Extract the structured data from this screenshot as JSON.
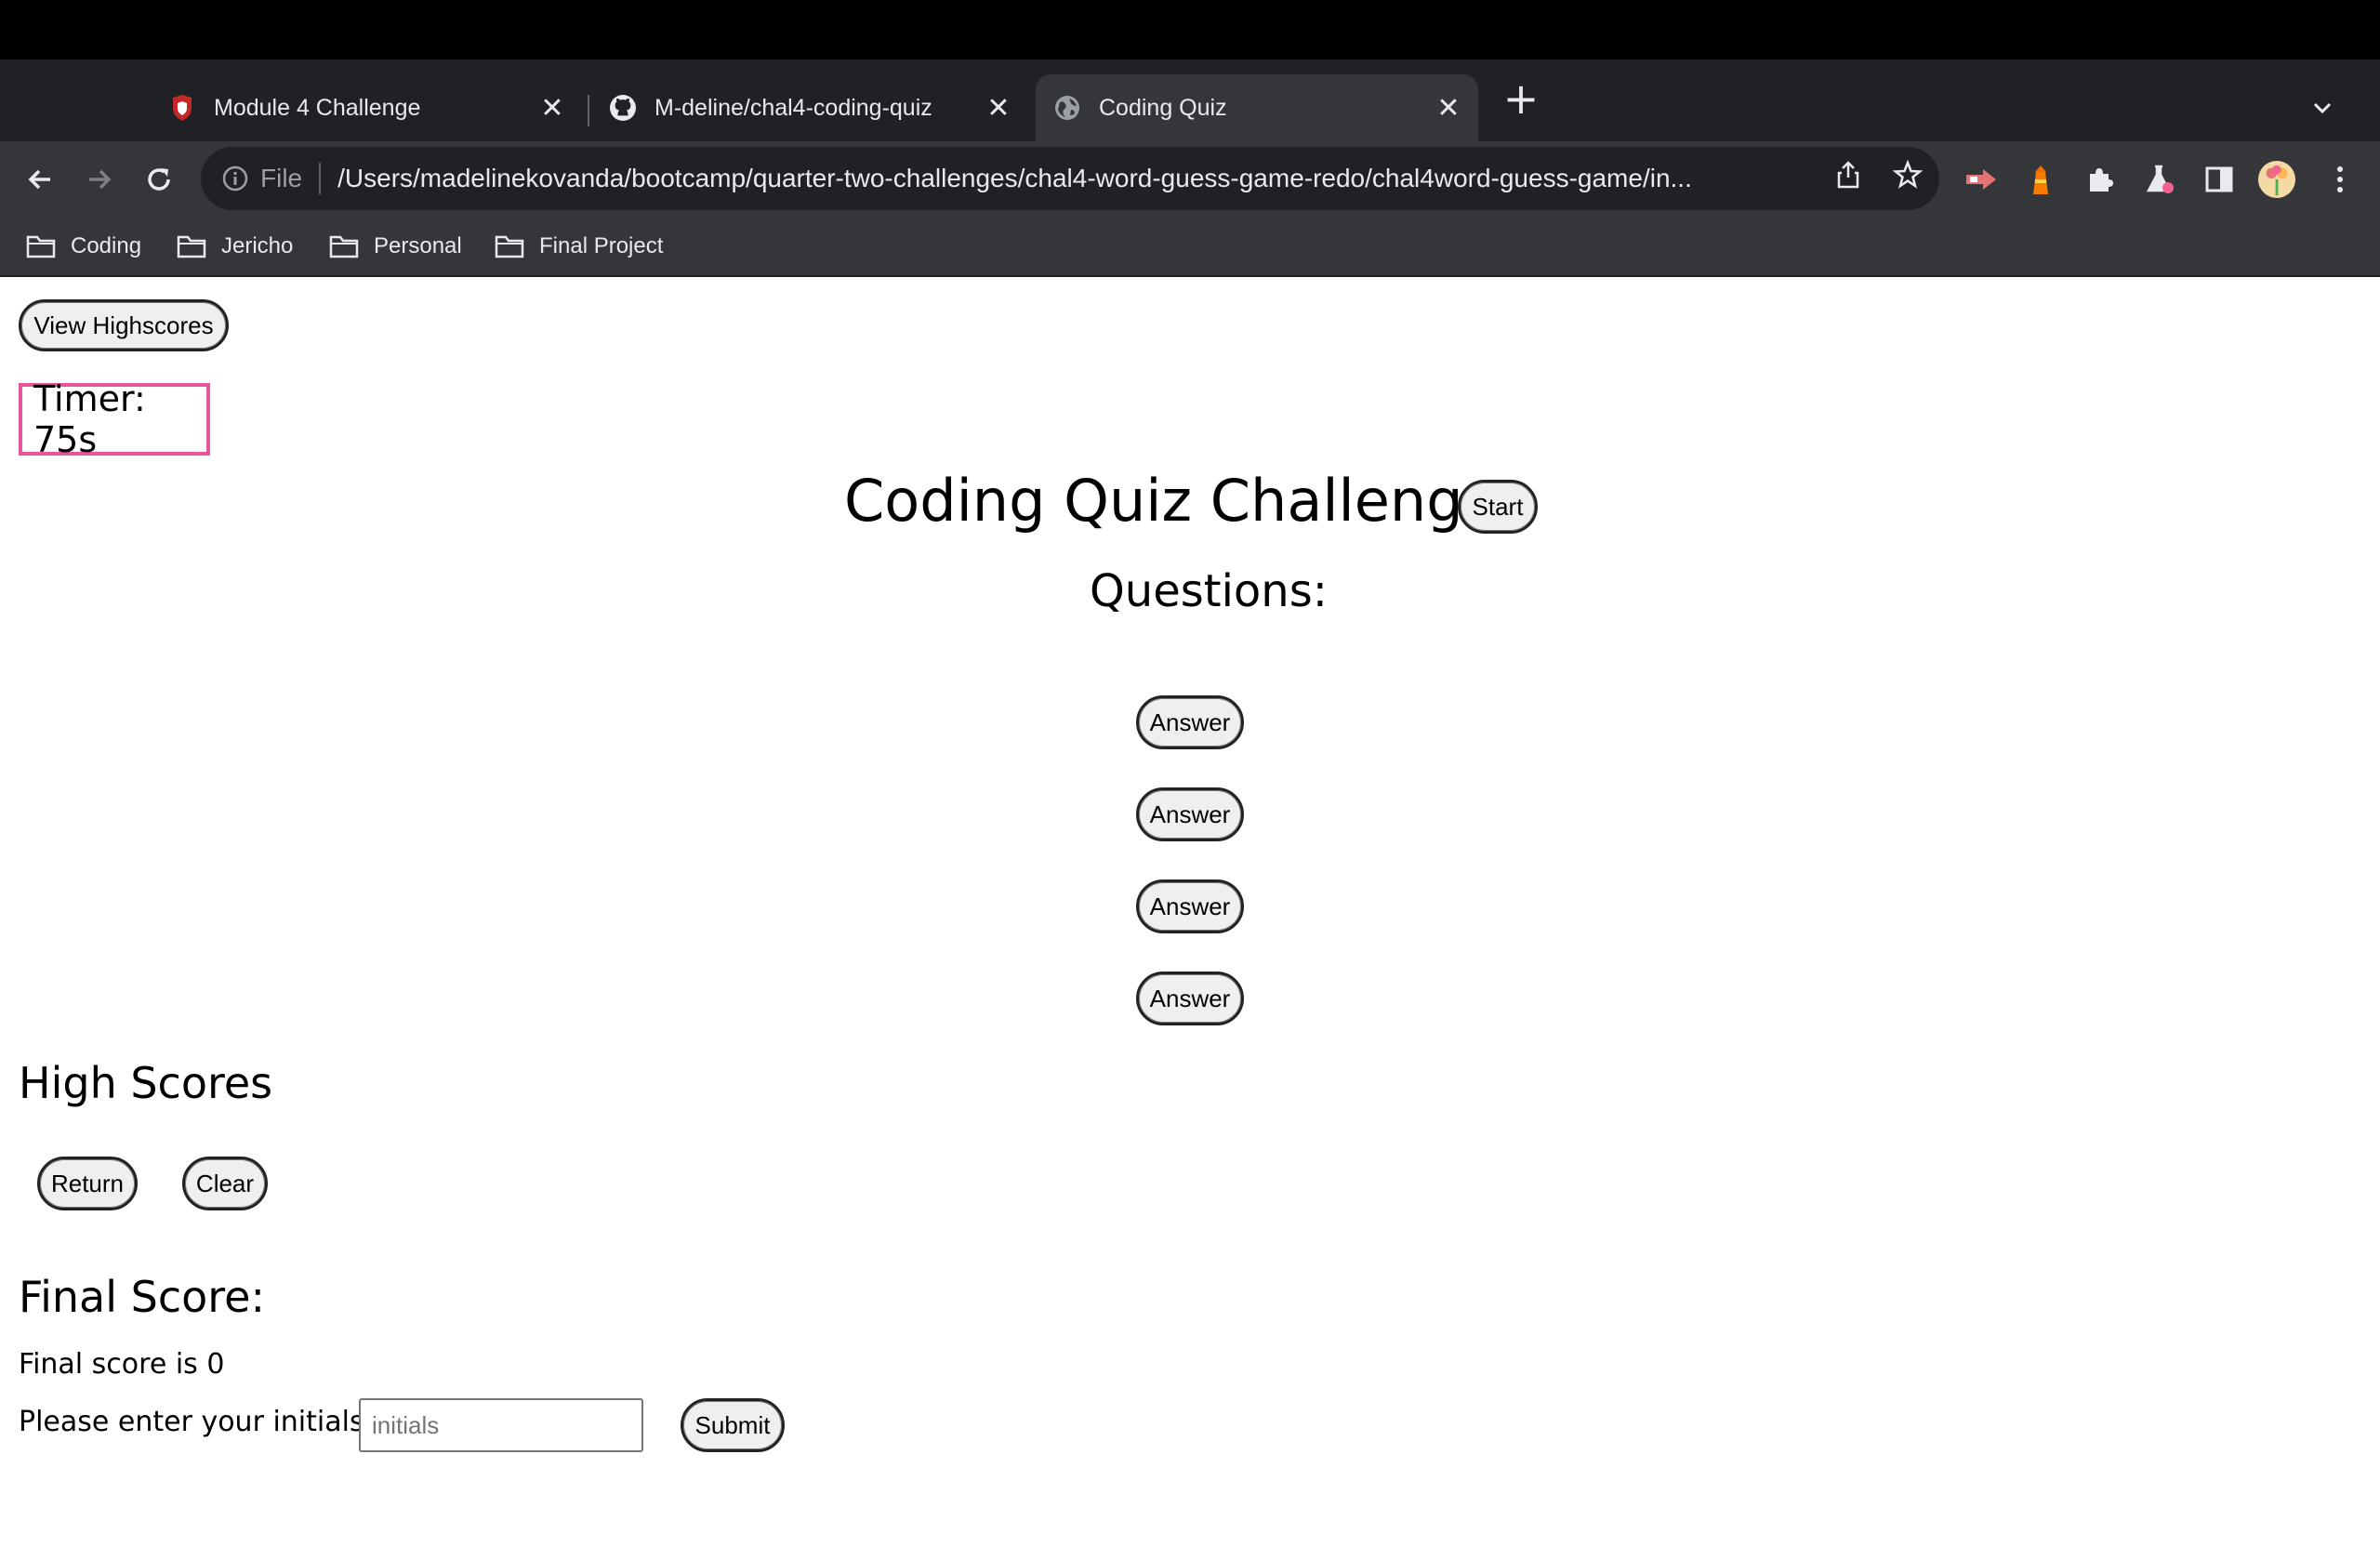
{
  "browser": {
    "tabs": [
      {
        "title": "Module 4 Challenge",
        "icon": "shield-favicon-icon",
        "active": false
      },
      {
        "title": "M-deline/chal4-coding-quiz",
        "icon": "github-icon",
        "active": false
      },
      {
        "title": "Coding Quiz",
        "icon": "globe-icon",
        "active": true
      }
    ],
    "new_tab": "+",
    "omnibox": {
      "scheme_label": "File",
      "url": "/Users/madelinekovanda/bootcamp/quarter-two-challenges/chal4-word-guess-game-redo/chal4word-guess-game/in..."
    },
    "bookmarks": [
      "Coding",
      "Jericho",
      "Personal",
      "Final Project"
    ],
    "colors": {
      "tabstrip": "#202124",
      "active_tab": "#35363a",
      "text": "#e8eaed"
    }
  },
  "page": {
    "view_highscores": "View Highscores",
    "timer": "Timer: 75s",
    "title": "Coding Quiz Challenge",
    "start": "Start",
    "questions_label": "Questions:",
    "answers": [
      "Answer",
      "Answer",
      "Answer",
      "Answer"
    ],
    "high_scores_title": "High Scores",
    "return": "Return",
    "clear": "Clear",
    "final_score_title": "Final Score:",
    "final_score_text": "Final score is 0",
    "initials_label": "Please enter your initials",
    "initials_placeholder": "initials",
    "submit": "Submit",
    "colors": {
      "timer_border": "#e8559a"
    }
  }
}
